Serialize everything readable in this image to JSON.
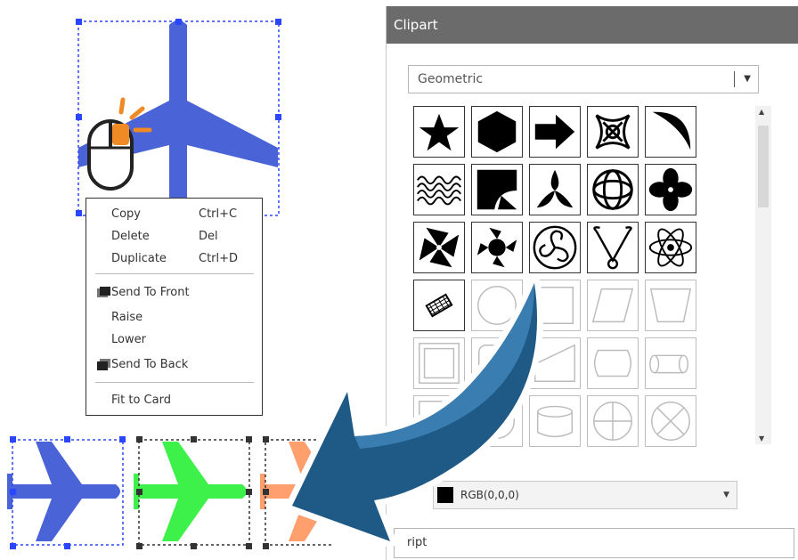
{
  "clipart_panel": {
    "title": "Clipart",
    "category_value": "Geometric",
    "clips": [
      [
        "star-icon",
        "hexagon-icon",
        "right-arrow-icon",
        "ornament-icon",
        "crescent-moon-icon"
      ],
      [
        "wave-pattern-icon",
        "folded-shape-icon",
        "trefoil-icon",
        "celtic-knot-icon",
        "quatrefoil-icon"
      ],
      [
        "pinwheel-icon",
        "swirl-star-icon",
        "triskelion-icon",
        "knot-y-icon",
        "atom-icon"
      ],
      [
        "diamond-pattern-icon",
        "circle-outline-icon",
        "square-outline-icon",
        "parallelogram-outline-icon",
        "trapezoid-outline-icon"
      ],
      [
        "frame-outline-icon",
        "rounded-square-outline-icon",
        "cut-corner-outline-icon",
        "barrel-outline-icon",
        "cylinder-outline-icon"
      ],
      [
        "frame-outline-icon",
        "circle-outline-icon",
        "cylinder-short-outline-icon",
        "circle-cross-outline-icon",
        "circle-x-outline-icon"
      ]
    ],
    "color_value": "RGB(0,0,0)",
    "script_value": "ript"
  },
  "context_menu": {
    "items": [
      {
        "label": "Copy",
        "shortcut": "Ctrl+C"
      },
      {
        "label": "Delete",
        "shortcut": "Del"
      },
      {
        "label": "Duplicate",
        "shortcut": "Ctrl+D"
      },
      {
        "label": "Send To Front",
        "shortcut": ""
      },
      {
        "label": "Raise",
        "shortcut": ""
      },
      {
        "label": "Lower",
        "shortcut": ""
      },
      {
        "label": "Send To Back",
        "shortcut": ""
      },
      {
        "label": "Fit to Card",
        "shortcut": ""
      }
    ]
  },
  "colors": {
    "plane_blue": "#4a63d6",
    "plane_green": "#3df14a",
    "plane_orange": "#ff9f6e",
    "arrow_blue": "#1f5a86",
    "mouse_accent": "#f08a24",
    "panel_title_bg": "#6b6b6b"
  }
}
